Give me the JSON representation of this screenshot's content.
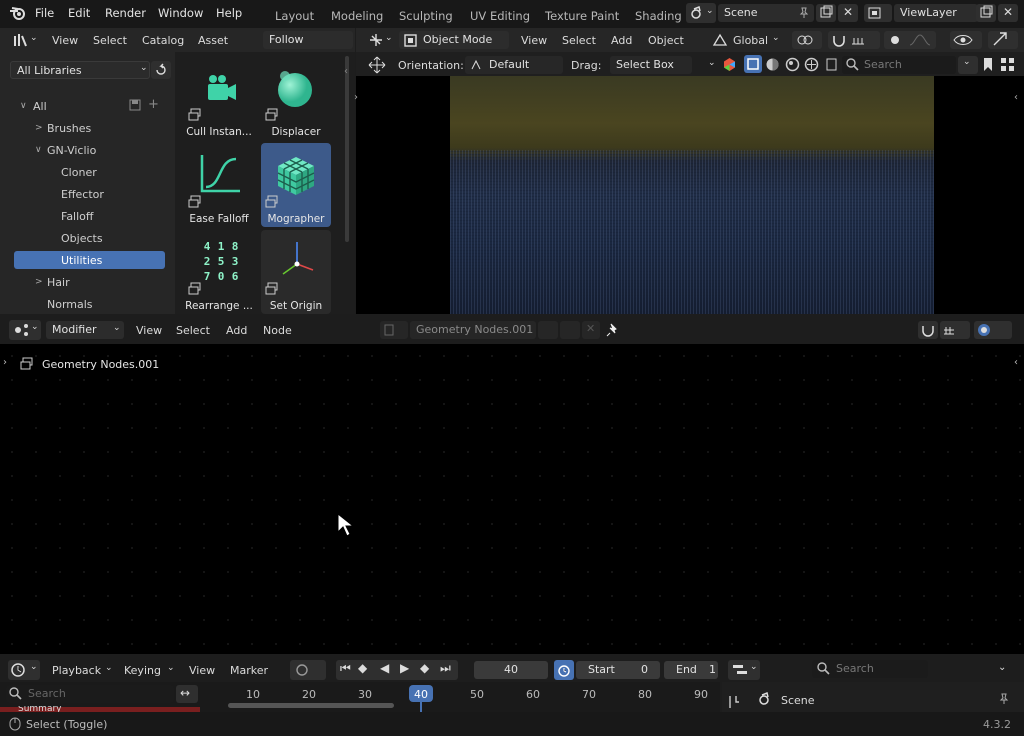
{
  "menubar": {
    "items": [
      "File",
      "Edit",
      "Render",
      "Window",
      "Help"
    ]
  },
  "workspaces": [
    "Layout",
    "Modeling",
    "Sculpting",
    "UV Editing",
    "Texture Paint",
    "Shading"
  ],
  "scene": {
    "label": "Scene"
  },
  "viewlayer": {
    "label": "ViewLayer"
  },
  "asset_browser": {
    "menus": [
      "View",
      "Select",
      "Catalog",
      "Asset"
    ],
    "follow_pref": "Follow Preferen",
    "library": "All Libraries",
    "tree": [
      {
        "label": "All",
        "expanded": true
      },
      {
        "label": "Brushes",
        "expanded": false
      },
      {
        "label": "GN-Viclio",
        "expanded": true
      },
      {
        "label": "Cloner"
      },
      {
        "label": "Effector"
      },
      {
        "label": "Falloff"
      },
      {
        "label": "Objects"
      },
      {
        "label": "Utilities"
      },
      {
        "label": "Hair",
        "expanded": false
      },
      {
        "label": "Normals"
      }
    ],
    "assets": [
      "Cull Instan...",
      "Displacer",
      "Ease Falloff",
      "Mographer",
      "Rearrange ...",
      "Set Origin"
    ],
    "grid_numbers": [
      "4",
      "1",
      "8",
      "2",
      "5",
      "3",
      "7",
      "0",
      "6"
    ]
  },
  "viewport": {
    "mode": "Object Mode",
    "menus": [
      "View",
      "Select",
      "Add",
      "Object"
    ],
    "transform": "Global",
    "orientation_label": "Orientation:",
    "orientation_value": "Default",
    "drag_label": "Drag:",
    "drag_value": "Select Box",
    "search_placeholder": "Search"
  },
  "node_editor": {
    "type": "Modifier",
    "menus": [
      "View",
      "Select",
      "Add",
      "Node"
    ],
    "tree_name": "Geometry Nodes.001",
    "breadcrumb": "Geometry Nodes.001"
  },
  "timeline": {
    "menus": [
      "Playback",
      "Keying",
      "View",
      "Marker"
    ],
    "frame": "40",
    "start_label": "Start",
    "start_value": "0",
    "end_label": "End",
    "end_value": "1",
    "search_placeholder": "Search",
    "ticks": [
      "10",
      "20",
      "30",
      "40",
      "50",
      "60",
      "70",
      "80",
      "90"
    ],
    "summary": "Summary"
  },
  "outliner": {
    "search_placeholder": "Search",
    "scene": "Scene"
  },
  "statusbar": {
    "hint": "Select (Toggle)",
    "version": "4.3.2"
  },
  "colors": {
    "accent": "#4772b3",
    "selection": "#3d5a8a",
    "teal": "#3fd3a8"
  }
}
